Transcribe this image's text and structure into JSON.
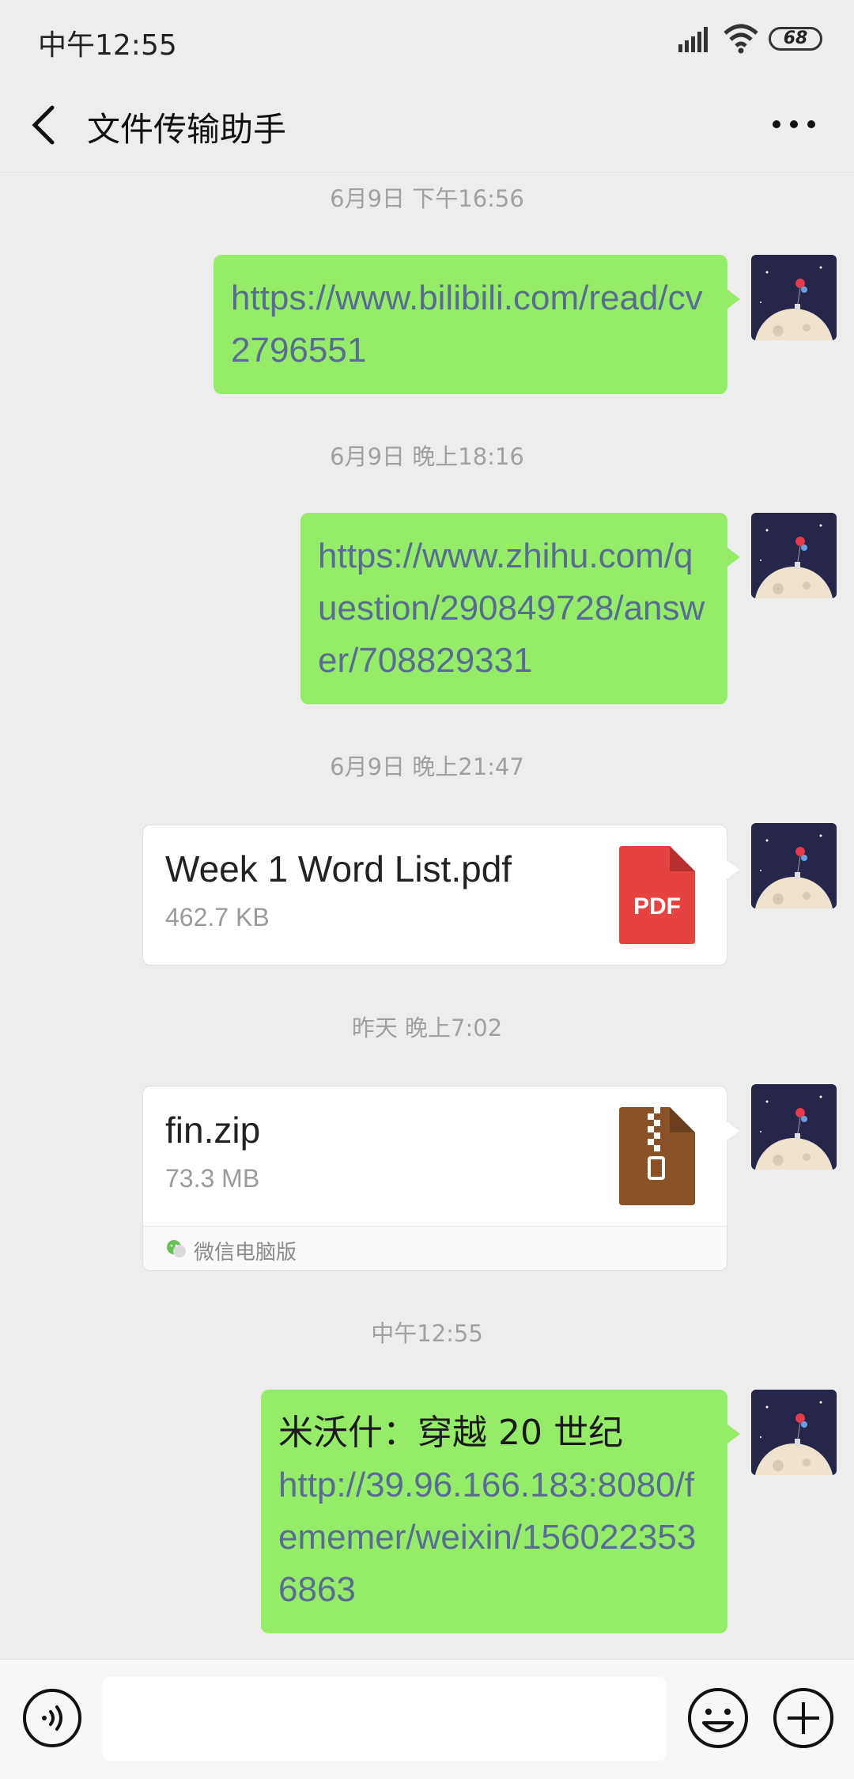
{
  "status": {
    "time": "中午12:55",
    "battery": "68"
  },
  "header": {
    "title": "文件传输助手"
  },
  "messages": [
    {
      "time": "6月9日 下午16:56",
      "text": "https://www.bilibili.com/read/cv2796551"
    },
    {
      "time": "6月9日 晚上18:16",
      "text": "https://www.zhihu.com/question/290849728/answer/708829331"
    },
    {
      "time": "6月9日 晚上21:47",
      "file_name": "Week 1 Word List.pdf",
      "file_size": "462.7 KB",
      "file_icon": "pdf-icon",
      "file_icon_label": "PDF"
    },
    {
      "time": "昨天 晚上7:02",
      "file_name": "fin.zip",
      "file_size": "73.3 MB",
      "file_icon": "zip-icon",
      "source": "微信电脑版"
    },
    {
      "time": "中午12:55",
      "title": "米沃什：穿越 20 世纪",
      "text": "http://39.96.166.183:8080/fememer/weixin/1560223536863"
    }
  ],
  "colors": {
    "bubble": "#95ec69",
    "link": "#586c94",
    "pdf": "#e64340",
    "zip": "#8b5228"
  }
}
